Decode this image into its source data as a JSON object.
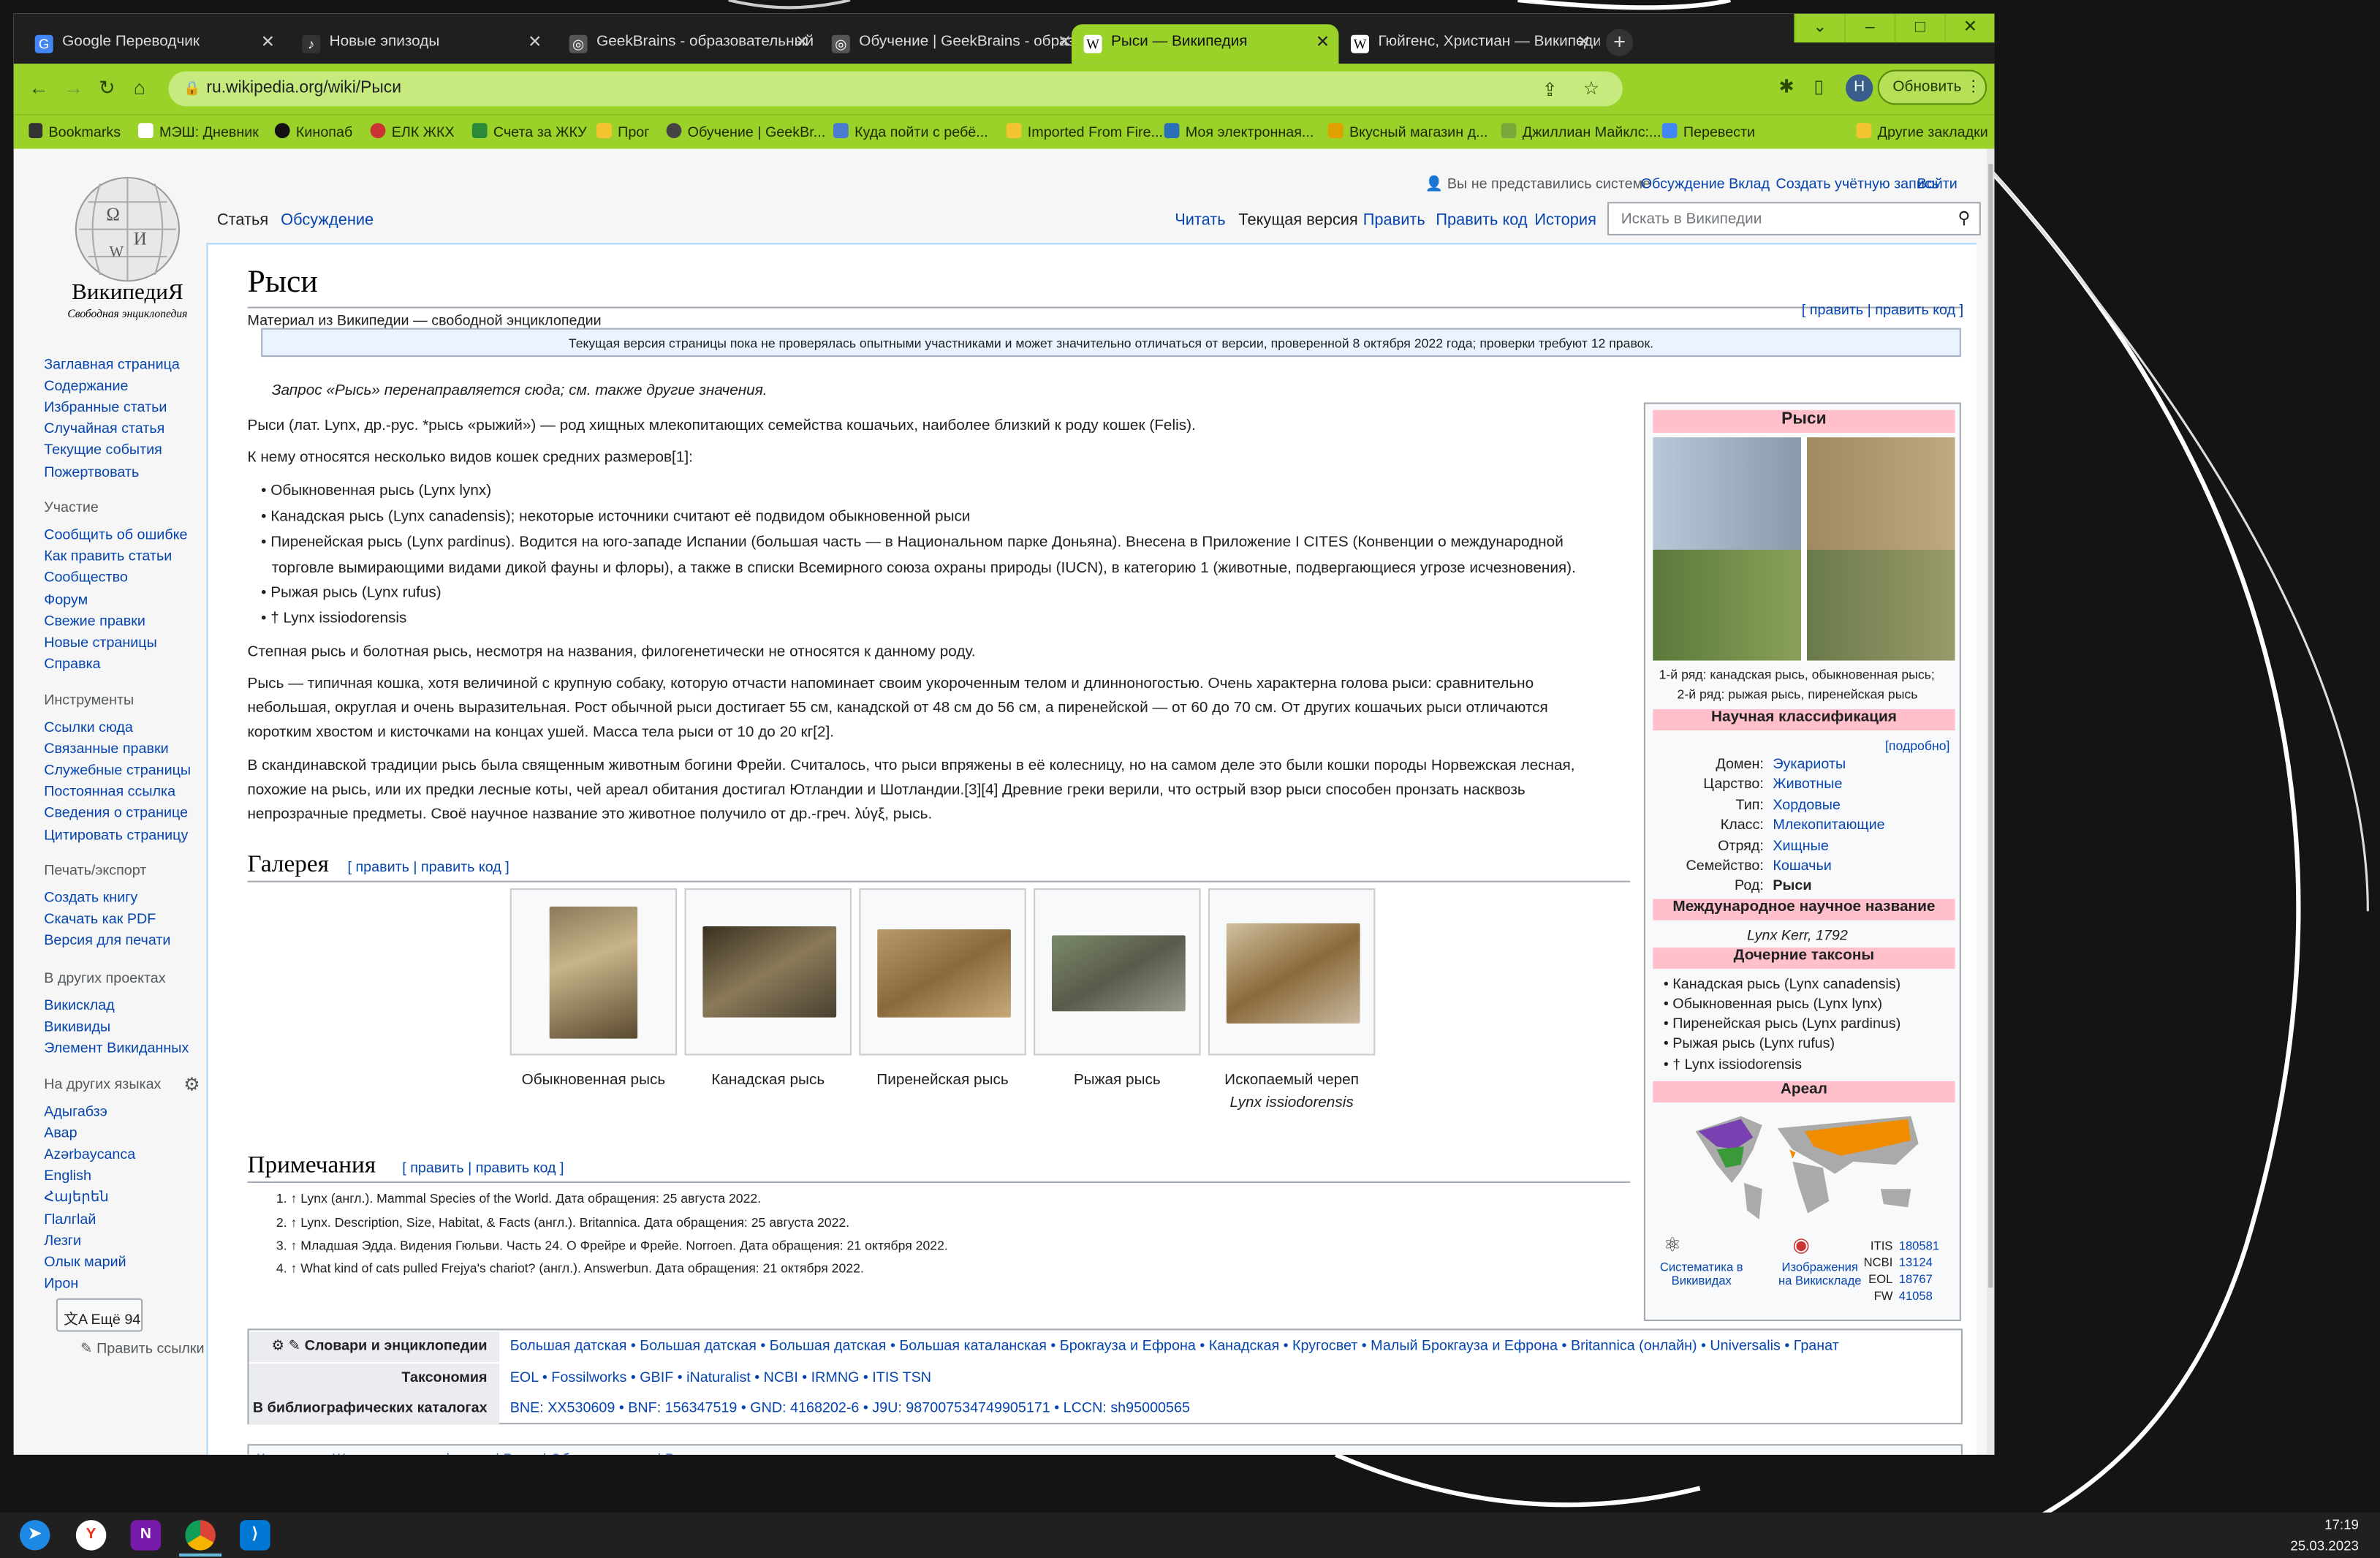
{
  "browser": {
    "tabs": [
      {
        "title": "Google Переводчик",
        "icon": "google-translate-icon"
      },
      {
        "title": "Новые эпизоды",
        "icon": "podcast-icon"
      },
      {
        "title": "GeekBrains - образовательный",
        "icon": "geekbrains-icon"
      },
      {
        "title": "Обучение | GeekBrains - образо",
        "icon": "geekbrains-icon"
      },
      {
        "title": "Рыси — Википедия",
        "icon": "wikipedia-icon",
        "active": true
      },
      {
        "title": "Гюйгенс, Христиан — Википеди",
        "icon": "wikipedia-icon"
      }
    ],
    "url": "ru.wikipedia.org/wiki/Рыси",
    "update_label": "Обновить",
    "avatar": "Н",
    "bookmarks": [
      "Bookmarks",
      "МЭШ: Дневник",
      "Кинопаб",
      "ЕЛК ЖКХ",
      "Счета за ЖКУ",
      "Прог",
      "Обучение | GeekBr...",
      "Куда пойти с ребё...",
      "Imported From Fire...",
      "Моя электронная...",
      "Вкусный магазин д...",
      "Джиллиан Майклс:...",
      "Перевести"
    ],
    "other_bookmarks": "Другие закладки",
    "accent": "#9bd22a"
  },
  "wiki": {
    "logo_title": "ВикипедиЯ",
    "logo_sub": "Свободная энциклопедия",
    "user_links": [
      "Вы не представились системе",
      "Обсуждение",
      "Вклад",
      "Создать учётную запись",
      "Войти"
    ],
    "page_tabs": [
      "Статья",
      "Обсуждение"
    ],
    "view_tabs": [
      "Читать",
      "Текущая версия",
      "Править",
      "Править код",
      "История"
    ],
    "search_placeholder": "Искать в Википедии",
    "sidebar": {
      "main": [
        "Заглавная страница",
        "Содержание",
        "Избранные статьи",
        "Случайная статья",
        "Текущие события",
        "Пожертвовать"
      ],
      "participation_h": "Участие",
      "participation": [
        "Сообщить об ошибке",
        "Как править статьи",
        "Сообщество",
        "Форум",
        "Свежие правки",
        "Новые страницы",
        "Справка"
      ],
      "tools_h": "Инструменты",
      "tools": [
        "Ссылки сюда",
        "Связанные правки",
        "Служебные страницы",
        "Постоянная ссылка",
        "Сведения о странице",
        "Цитировать страницу"
      ],
      "print_h": "Печать/экспорт",
      "print": [
        "Создать книгу",
        "Скачать как PDF",
        "Версия для печати"
      ],
      "projects_h": "В других проектах",
      "projects": [
        "Викисклад",
        "Викивиды",
        "Элемент Викиданных"
      ],
      "langs_h": "На других языках",
      "langs": [
        "Адыгабзэ",
        "Авар",
        "Azərbaycanca",
        "English",
        "Հայերեն",
        "Гӏалгӏай",
        "Лезги",
        "Олык марий",
        "Ирон"
      ],
      "more_langs": "Ещё 94",
      "edit_links": "Править ссылки"
    },
    "title": "Рыси",
    "from": "Материал из Википедии — свободной энциклопедии",
    "edit_top": "[ править | править код ]",
    "flagged": "Текущая версия страницы пока не проверялась опытными участниками и может значительно отличаться от версии, проверенной 8 октября 2022 года; проверки требуют 12 правок.",
    "hatnote": "Запрос «Рысь» перенаправляется сюда; см. также другие значения.",
    "p1": "Рыси (лат. Lynx, др.-рус. *рысь «рыжий») — род хищных млекопитающих семейства кошачьих, наиболее близкий к роду кошек (Felis).",
    "p2": "К нему относятся несколько видов кошек средних размеров[1]:",
    "list": [
      "Обыкновенная рысь (Lynx lynx)",
      "Канадская рысь (Lynx canadensis); некоторые источники считают её подвидом обыкновенной рыси",
      "Пиренейская рысь (Lynx pardinus). Водится на юго-западе Испании (большая часть — в Национальном парке Доньяна). Внесена в Приложение I CITES (Конвенции о международной",
      "торговле вымирающими видами дикой фауны и флоры), а также в списки Всемирного союза охраны природы (IUCN), в категорию 1 (животные, подвергающиеся угрозе исчезновения).",
      "Рыжая рысь (Lynx rufus)",
      "† Lynx issiodorensis"
    ],
    "p3": "Степная рысь и болотная рысь, несмотря на названия, филогенетически не относятся к данному роду.",
    "p4": [
      "Рысь — типичная кошка, хотя величиной с крупную собаку, которую отчасти напоминает своим укороченным телом и длинноногостью. Очень характерна голова рыси: сравнительно",
      "небольшая, округлая и очень выразительная. Рост обычной рыси достигает 55 см, канадской от 48 см до 56 см, а пиренейской — от 60 до 70 см. От других кошачьих рыси отличаются",
      "коротким хвостом и кисточками на концах ушей. Масса тела рыси от 10 до 20 кг[2]."
    ],
    "p5": [
      "В скандинавской традиции рысь была священным животным богини Фрейи. Считалось, что рыси впряжены в её колесницу, но на самом деле это были кошки породы Норвежская лесная,",
      "похожие на рысь, или их предки лесные коты, чей ареал обитания достигал Ютландии и Шотландии.[3][4] Древние греки верили, что острый взор рыси способен пронзать насквозь",
      "непрозрачные предметы. Своё научное название это животное получило от др.-греч. λύγξ, рысь."
    ],
    "gallery_h": "Галерея",
    "gallery_edit": "[ править | править код ]",
    "gallery": [
      {
        "cap": "Обыкновенная рысь",
        "cap2": ""
      },
      {
        "cap": "Канадская рысь",
        "cap2": ""
      },
      {
        "cap": "Пиренейская рысь",
        "cap2": ""
      },
      {
        "cap": "Рыжая рысь",
        "cap2": ""
      },
      {
        "cap": "Ископаемый череп",
        "cap2": "Lynx issiodorensis"
      }
    ],
    "notes_h": "Примечания",
    "notes_edit": "[ править | править код ]",
    "notes": [
      "1. ↑ Lynx (англ.). Mammal Species of the World. Дата обращения: 25 августа 2022.",
      "2. ↑ Lynx. Description, Size, Habitat, & Facts (англ.). Britannica. Дата обращения: 25 августа 2022.",
      "3. ↑ Младшая Эдда. Видения Гюльви. Часть 24. О Фрейре и Фрейе. Norroen. Дата обращения: 21 октября 2022.",
      "4. ↑ What kind of cats pulled Frejya's chariot? (англ.). Answerbun. Дата обращения: 21 октября 2022."
    ],
    "infobox": {
      "title": "Рыси",
      "caption1": "1-й ряд: канадская рысь, обыкновенная рысь;",
      "caption2": "2-й ряд: рыжая рысь, пиренейская рысь",
      "class_h": "Научная классификация",
      "more": "[подробно]",
      "rows": [
        [
          "Домен:",
          "Эукариоты"
        ],
        [
          "Царство:",
          "Животные"
        ],
        [
          "Тип:",
          "Хордовые"
        ],
        [
          "Класс:",
          "Млекопитающие"
        ],
        [
          "Отряд:",
          "Хищные"
        ],
        [
          "Семейство:",
          "Кошачьи"
        ],
        [
          "Род:",
          "Рыси"
        ]
      ],
      "intl_h": "Международное научное название",
      "intl": "Lynx Kerr, 1792",
      "child_h": "Дочерние таксоны",
      "child": [
        "• Канадская рысь (Lynx canadensis)",
        "• Обыкновенная рысь (Lynx lynx)",
        "• Пиренейская рысь (Lynx pardinus)",
        "• Рыжая рысь (Lynx rufus)",
        "• † Lynx issiodorensis"
      ],
      "area_h": "Ареал",
      "wv": "Систематика в Викивидах",
      "wc": "Изображения на Викискладе",
      "ids": [
        [
          "ITIS",
          "180581"
        ],
        [
          "NCBI",
          "13124"
        ],
        [
          "EOL",
          "18767"
        ],
        [
          "FW",
          "41058"
        ]
      ]
    },
    "navbox": [
      {
        "h": "Словари и энциклопедии",
        "links": "Большая датская • Большая датская • Большая датская • Большая каталанская • Брокгауза и Ефрона • Канадская • Кругосвет • Малый Брокгауза и Ефрона • Britannica (онлайн) • Universalis • Гранат"
      },
      {
        "h": "Таксономия",
        "links": "EOL • Fossilworks • GBIF • iNaturalist • NCBI • IRMNG • ITIS TSN"
      },
      {
        "h": "В библиографических каталогах",
        "links": "BNE: XX530609 • BNF: 156347519 • GND: 4168202-6 • J9U: 987007534749905171 • LCCN: sh95000565"
      }
    ],
    "categories": "Категории: Животные по алфавиту | Рыси | Объекты охоты | Роды млекопитающих"
  },
  "taskbar": {
    "time": "17:19",
    "date": "25.03.2023"
  }
}
